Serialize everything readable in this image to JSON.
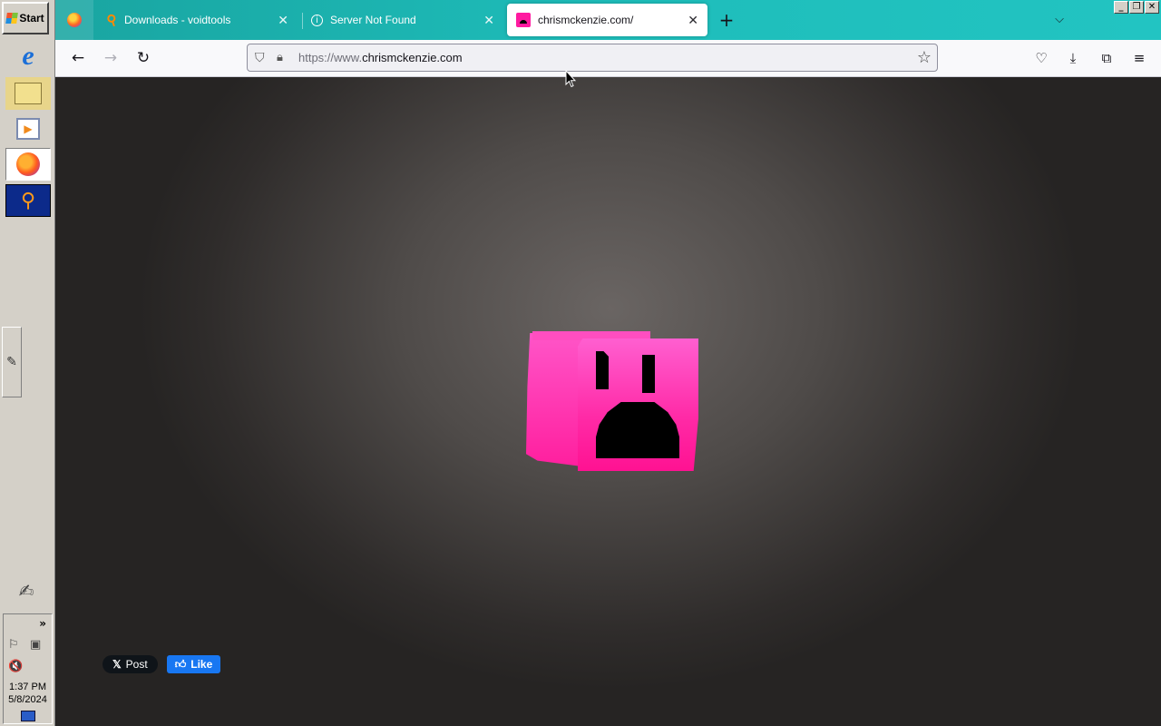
{
  "taskbar": {
    "start_label": "Start",
    "quick_launch": [
      {
        "name": "internet-explorer-icon"
      },
      {
        "name": "windows-explorer-icon"
      },
      {
        "name": "media-player-icon"
      },
      {
        "name": "firefox-icon"
      },
      {
        "name": "everything-search-icon"
      }
    ],
    "tray_expand": "»",
    "time": "1:37 PM",
    "date": "5/8/2024"
  },
  "browser": {
    "tabs": [
      {
        "title": "Downloads - voidtools",
        "icon": "magnifier-icon",
        "close": "✕"
      },
      {
        "title": "Server Not Found",
        "icon": "info-icon",
        "close": "✕"
      },
      {
        "title": "chrismckenzie.com/",
        "icon": "pink-cube-icon",
        "close": "✕",
        "active": true
      }
    ],
    "new_tab": "+",
    "url_prefix": "https://www.",
    "url_domain": "chrismckenzie.com"
  },
  "page": {
    "x_post_label": "Post",
    "x_logo": "𝕏",
    "fb_like_label": "Like",
    "accent_pink": "#ff2aa6"
  },
  "colors": {
    "tabstrip": "#1ebdba",
    "page_bg": "#4f4b49",
    "fb_blue": "#1877f2"
  }
}
